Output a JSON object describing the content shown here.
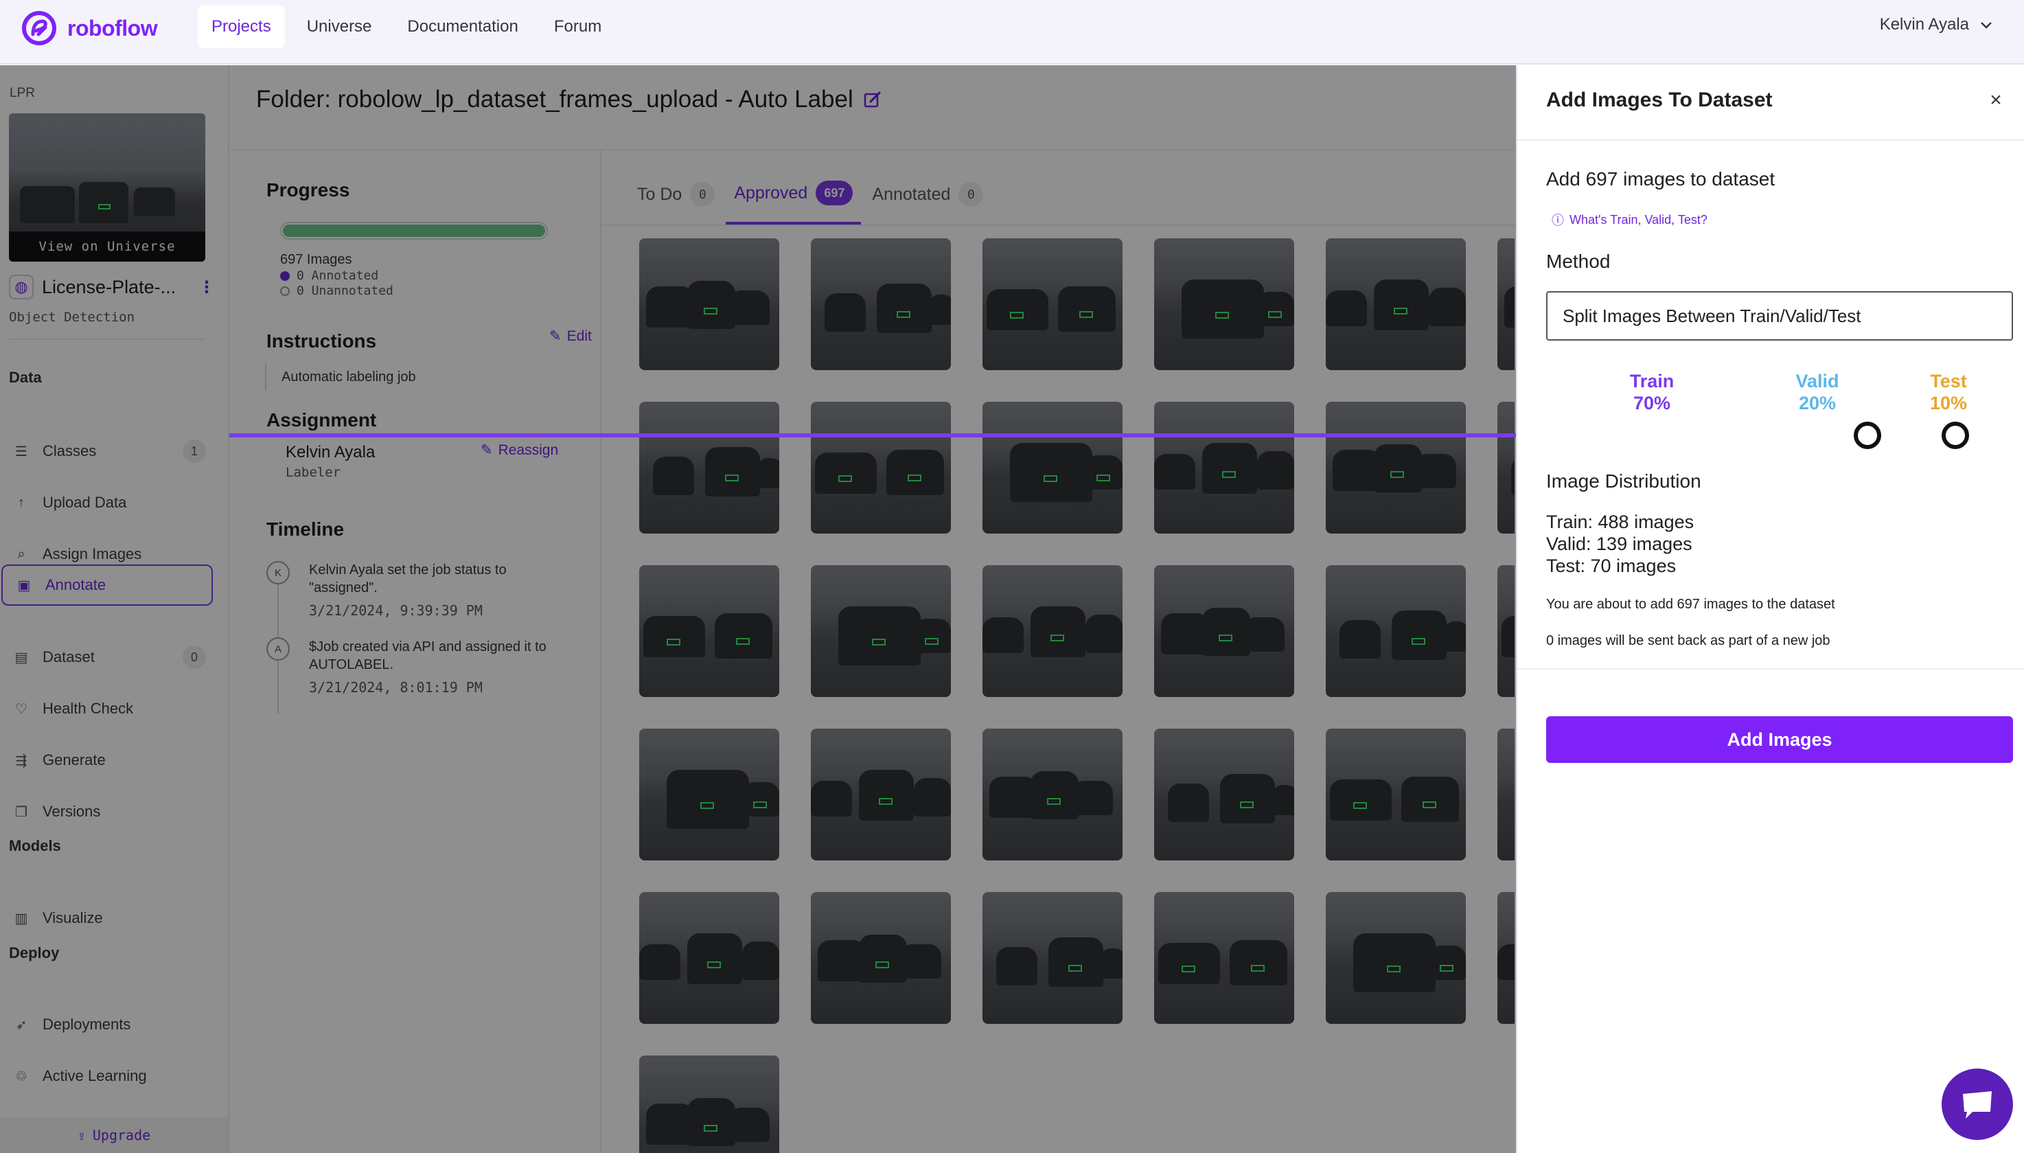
{
  "nav": {
    "brand": "roboflow",
    "items": [
      "Projects",
      "Universe",
      "Documentation",
      "Forum"
    ],
    "user": "Kelvin Ayala"
  },
  "sidebar": {
    "workspace_tag": "LPR",
    "view_on_universe": "View on Universe",
    "project_name": "License-Plate-...",
    "project_type": "Object Detection",
    "section_data": "Data",
    "section_models": "Models",
    "section_deploy": "Deploy",
    "items": [
      {
        "label": "Classes",
        "icon": "list-icon",
        "count": "1"
      },
      {
        "label": "Upload Data",
        "icon": "upload-icon"
      },
      {
        "label": "Assign Images",
        "icon": "search-icon"
      },
      {
        "label": "Annotate",
        "icon": "annotate-icon",
        "active": true
      },
      {
        "label": "Dataset",
        "icon": "images-icon",
        "count": "0"
      },
      {
        "label": "Health Check",
        "icon": "heart-icon"
      },
      {
        "label": "Generate",
        "icon": "generate-icon"
      },
      {
        "label": "Versions",
        "icon": "versions-icon"
      },
      {
        "label": "Visualize",
        "icon": "chart-icon"
      },
      {
        "label": "Deployments",
        "icon": "rocket-icon"
      },
      {
        "label": "Active Learning",
        "icon": "recycle-icon"
      }
    ],
    "upgrade": "Upgrade"
  },
  "header": {
    "title": "Folder: robolow_lp_dataset_frames_upload - Auto Label"
  },
  "job": {
    "progress_heading": "Progress",
    "progress_annotated_fraction": 1.0,
    "image_count": "697 Images",
    "annotated": "0 Annotated",
    "unannotated": "0 Unannotated",
    "instructions_heading": "Instructions",
    "edit_label": "Edit",
    "instructions_text": "Automatic labeling job",
    "assignment_heading": "Assignment",
    "reassign_label": "Reassign",
    "assignee": "Kelvin Ayala",
    "assignee_role": "Labeler",
    "timeline_heading": "Timeline",
    "timeline": [
      {
        "badge": "K",
        "text": "Kelvin Ayala set the job status to \"assigned\".",
        "date": "3/21/2024, 9:39:39 PM"
      },
      {
        "badge": "A",
        "text": "$Job created via API and assigned it to AUTOLABEL.",
        "date": "3/21/2024, 8:01:19 PM"
      }
    ]
  },
  "tabs": [
    {
      "label": "To Do",
      "count": "0"
    },
    {
      "label": "Approved",
      "count": "697",
      "active": true
    },
    {
      "label": "Annotated",
      "count": "0"
    }
  ],
  "drawer": {
    "title": "Add Images To Dataset",
    "subtitle": "Add 697 images to dataset",
    "help_link": "What's Train, Valid, Test?",
    "method_heading": "Method",
    "method_value": "Split Images Between Train/Valid/Test",
    "split": [
      {
        "name": "Train",
        "pct": "70%",
        "color": "#7c3aed"
      },
      {
        "name": "Valid",
        "pct": "20%",
        "color": "#5db7ea"
      },
      {
        "name": "Test",
        "pct": "10%",
        "color": "#e7a72c"
      }
    ],
    "distribution_heading": "Image Distribution",
    "train_count": "Train: 488 images",
    "valid_count": "Valid: 139 images",
    "test_count": "Test: 70 images",
    "notice_add": "You are about to add 697 images to the dataset",
    "notice_back": "0 images will be sent back as part of a new job",
    "add_button": "Add Images"
  }
}
